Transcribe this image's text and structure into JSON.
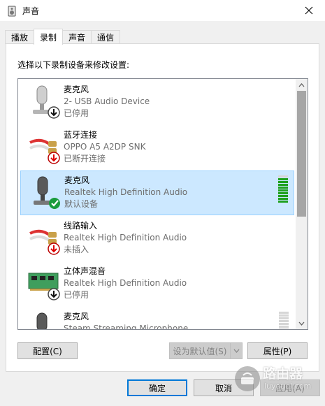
{
  "window": {
    "title": "声音"
  },
  "tabs": [
    {
      "label": "播放"
    },
    {
      "label": "录制"
    },
    {
      "label": "声音"
    },
    {
      "label": "通信"
    }
  ],
  "instruction": "选择以下录制设备来修改设置:",
  "devices": [
    {
      "name": "麦克风",
      "desc": "2- USB Audio Device",
      "status": "已停用",
      "icon": "microphone-icon",
      "badge": "disabled-down-arrow-icon"
    },
    {
      "name": "蓝牙连接",
      "desc": "OPPO A5 A2DP SNK",
      "status": "已断开连接",
      "icon": "rca-cable-icon",
      "badge": "disconnected-red-arrow-icon"
    },
    {
      "name": "麦克风",
      "desc": "Realtek High Definition Audio",
      "status": "默认设备",
      "icon": "microphone-icon",
      "badge": "default-check-icon",
      "level": 0.85
    },
    {
      "name": "线路输入",
      "desc": "Realtek High Definition Audio",
      "status": "未插入",
      "icon": "rca-cable-icon",
      "badge": "unplugged-red-arrow-icon"
    },
    {
      "name": "立体声混音",
      "desc": "Realtek High Definition Audio",
      "status": "已停用",
      "icon": "sound-card-icon",
      "badge": "disabled-down-arrow-icon"
    },
    {
      "name": "麦克风",
      "desc": "Steam Streaming Microphone",
      "status": "",
      "icon": "microphone-icon",
      "badge": "",
      "level": 0
    }
  ],
  "buttons": {
    "configure": "配置(C)",
    "set_default": "设为默认值(S)",
    "properties": "属性(P)",
    "ok": "确定",
    "cancel": "取消",
    "apply": "应用(A)"
  },
  "watermark": {
    "text": "路由器",
    "sub": "luyouqi.com"
  },
  "colors": {
    "selection": "#cce8ff",
    "accent": "#0078d7",
    "meter_on": "#1ea01e"
  }
}
